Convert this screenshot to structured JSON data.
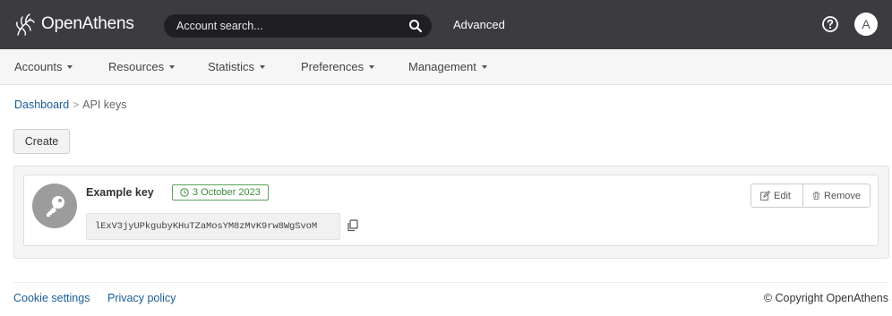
{
  "header": {
    "brand": "OpenAthens",
    "search_placeholder": "Account search...",
    "advanced_label": "Advanced",
    "avatar_initial": "A"
  },
  "nav": {
    "items": [
      {
        "label": "Accounts"
      },
      {
        "label": "Resources"
      },
      {
        "label": "Statistics"
      },
      {
        "label": "Preferences"
      },
      {
        "label": "Management"
      }
    ]
  },
  "breadcrumb": {
    "home": "Dashboard",
    "separator": ">",
    "current": "API keys"
  },
  "toolbar": {
    "create_label": "Create"
  },
  "api_key": {
    "name": "Example key",
    "date": "3 October 2023",
    "value": "lExV3jyUPkgubyKHuTZaMosYM8zMvK9rw8WgSvoM",
    "edit_label": "Edit",
    "remove_label": "Remove"
  },
  "footer": {
    "cookie_settings": "Cookie settings",
    "privacy_policy": "Privacy policy",
    "copyright": "© Copyright OpenAthens"
  },
  "colors": {
    "topbar": "#3b3b40",
    "search_bg": "#1f1f23",
    "link": "#1a5d96",
    "badge_green": "#3e8a3e"
  }
}
